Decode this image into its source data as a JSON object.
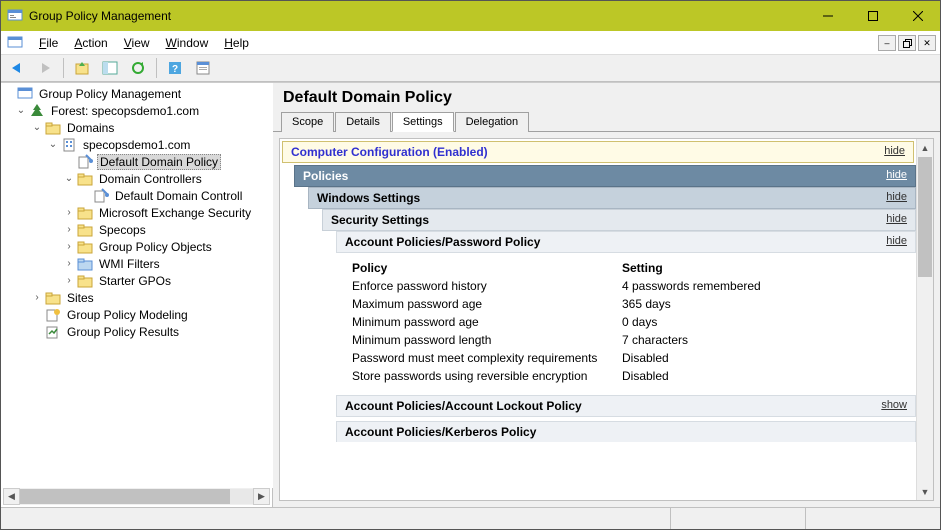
{
  "window": {
    "title": "Group Policy Management"
  },
  "menu": {
    "file": "File",
    "action": "Action",
    "view": "View",
    "window": "Window",
    "help": "Help"
  },
  "tree": {
    "root": "Group Policy Management",
    "forest": "Forest: specopsdemo1.com",
    "domains": "Domains",
    "domain": "specopsdemo1.com",
    "ddp": "Default Domain Policy",
    "dc": "Domain Controllers",
    "ddcp": "Default Domain Controll",
    "mes": "Microsoft Exchange Security",
    "specops": "Specops",
    "gpo": "Group Policy Objects",
    "wmi": "WMI Filters",
    "starter": "Starter GPOs",
    "sites": "Sites",
    "gpm": "Group Policy Modeling",
    "gpr": "Group Policy Results"
  },
  "content": {
    "title": "Default Domain Policy",
    "tabs": {
      "scope": "Scope",
      "details": "Details",
      "settings": "Settings",
      "delegation": "Delegation"
    },
    "sections": {
      "cc": "Computer Configuration (Enabled)",
      "policies": "Policies",
      "ws": "Windows Settings",
      "ss": "Security Settings",
      "app": "Account Policies/Password Policy",
      "alp": "Account Policies/Account Lockout Policy",
      "akp": "Account Policies/Kerberos Policy",
      "hide": "hide",
      "show": "show"
    },
    "table": {
      "h1": "Policy",
      "h2": "Setting",
      "rows": [
        {
          "p": "Enforce password history",
          "s": "4 passwords remembered"
        },
        {
          "p": "Maximum password age",
          "s": "365 days"
        },
        {
          "p": "Minimum password age",
          "s": "0 days"
        },
        {
          "p": "Minimum password length",
          "s": "7 characters"
        },
        {
          "p": "Password must meet complexity requirements",
          "s": "Disabled"
        },
        {
          "p": "Store passwords using reversible encryption",
          "s": "Disabled"
        }
      ]
    }
  }
}
